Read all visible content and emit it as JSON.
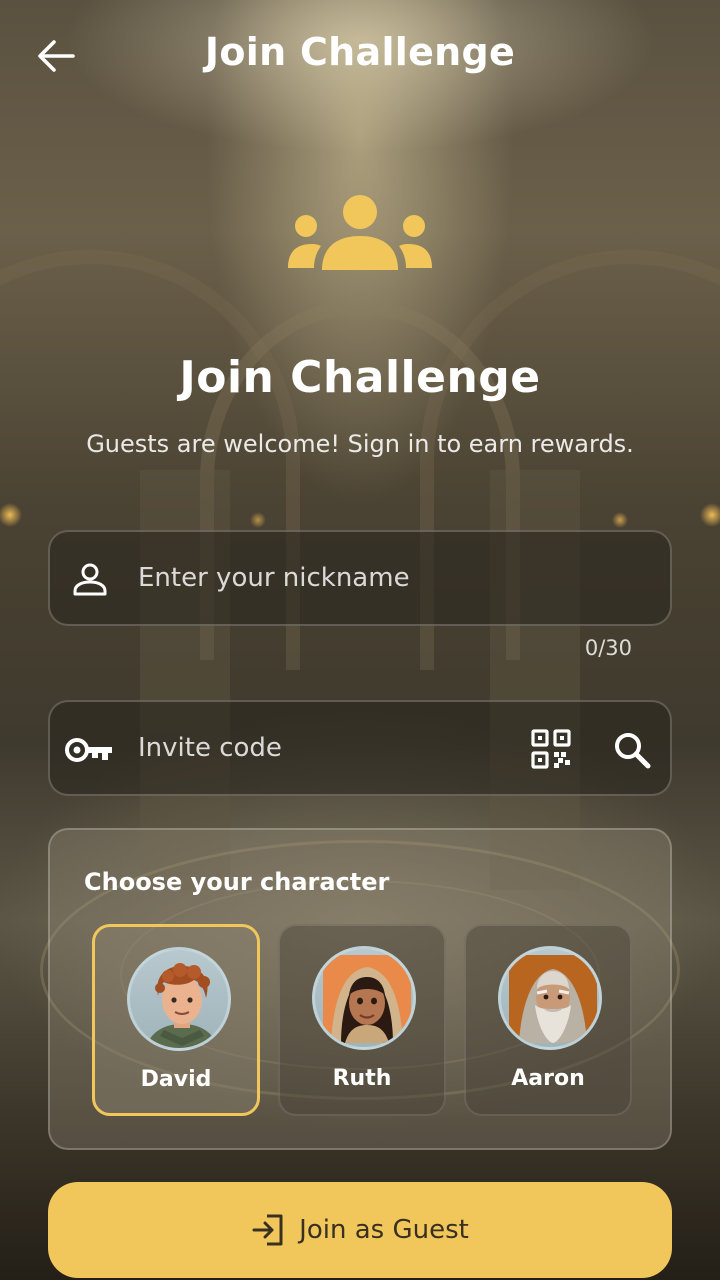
{
  "header": {
    "title": "Join Challenge",
    "back_icon": "arrow-left-icon"
  },
  "hero": {
    "icon": "group-icon",
    "title": "Join Challenge",
    "subtitle": "Guests are welcome! Sign in to earn rewards."
  },
  "nickname": {
    "icon": "person-icon",
    "placeholder": "Enter your nickname",
    "value": "",
    "counter": "0/30"
  },
  "invite": {
    "icon": "key-icon",
    "placeholder": "Invite code",
    "value": "",
    "qr_icon": "qr-code-icon",
    "search_icon": "search-icon"
  },
  "characters": {
    "title": "Choose your character",
    "items": [
      {
        "name": "David",
        "selected": true
      },
      {
        "name": "Ruth",
        "selected": false
      },
      {
        "name": "Aaron",
        "selected": false
      }
    ]
  },
  "join_button": {
    "label": "Join as Guest",
    "icon": "login-icon"
  },
  "colors": {
    "accent": "#f1c75c",
    "button_text": "#3a3020"
  }
}
